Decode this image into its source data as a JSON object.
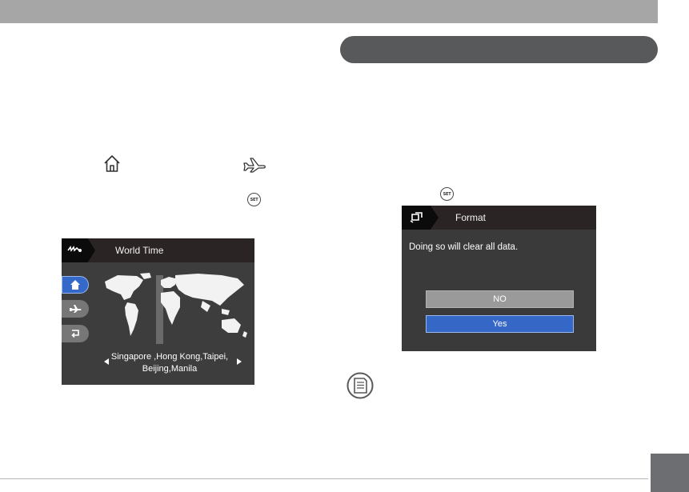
{
  "world_time_screen": {
    "title": "World Time",
    "city_line1": "Singapore ,Hong Kong,Taipei,",
    "city_line2": "Beijing,Manila",
    "side_buttons": [
      "home-icon",
      "airplane-icon",
      "return-icon"
    ]
  },
  "format_screen": {
    "title": "Format",
    "message": "Doing so will clear all data.",
    "no_label": "NO",
    "yes_label": "Yes"
  },
  "set_button_label": "SET",
  "colors": {
    "section_pill": "#58595b",
    "top_band": "#a6a6a6",
    "selected_blue": "#3467c6",
    "page_box": "#6d6e71"
  }
}
